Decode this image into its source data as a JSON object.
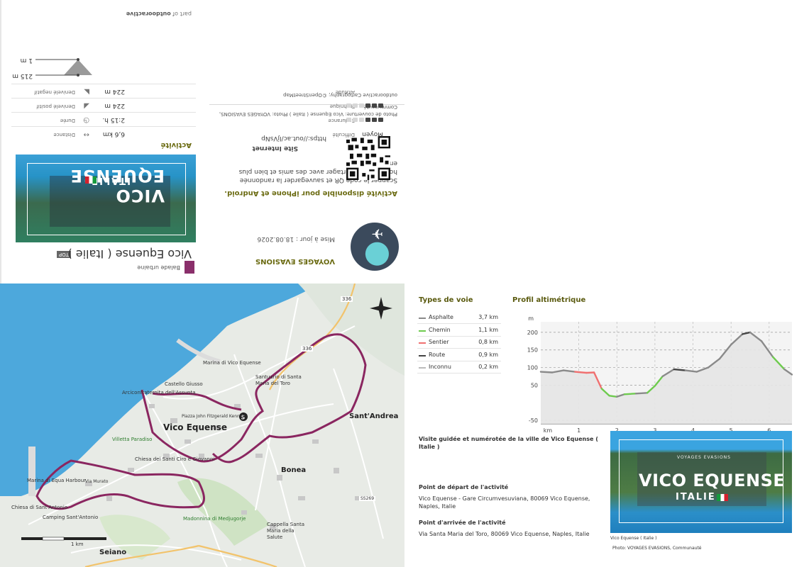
{
  "back_cover": {
    "part_of_prefix": "part of ",
    "part_of_brand": "outdooractive",
    "brand_name": "VOYAGES EVASIONS",
    "updated": "Mise à jour : 18.08.2026",
    "app_title": "Activité disponible pour iPhone et Android.",
    "app_desc": "Scanner le code QR et sauvegarder la randonnée hors-ligne, la partager avec des amis et bien plus encore ...",
    "website_label": "Site Internet",
    "website_url": "https://out.ac/IjVsNp",
    "photo_credit": "Photo de couverture: Vico Equense ( Italie ) Photo: VOYAGES EVASIONS, Communauté",
    "cartography": "outdooractive Cartography; ©OpenStreetMap",
    "activity_type": "Balade urbaine",
    "top_badge": "TOP",
    "main_title": "Vico Equense ( Italie )",
    "cover_title": "VICO EQUENSE",
    "cover_subtitle": "ITALIE",
    "activity_heading": "Activité",
    "stats": [
      {
        "label": "Distance",
        "value": "6,6  km",
        "extra_label": "Difficulté",
        "extra_value": "Moyen"
      },
      {
        "label": "Durée",
        "value": "2:15  h.",
        "extra_label": "Endurance",
        "level": 3
      },
      {
        "label": "Denivelé positif",
        "value": "224  m",
        "extra_label": "Technique",
        "level": 3
      },
      {
        "label": "Denivelé negatif",
        "value": "224  m",
        "extra_label": "Altitude"
      }
    ],
    "altitude_max": "215 m",
    "altitude_min": "1 m"
  },
  "map": {
    "places": {
      "vico": "Vico Equense",
      "bonea": "Bonea",
      "sant_andrea": "Sant'Andrea",
      "seiano": "Seiano",
      "marina_equa": "Marina di Equa Harbour",
      "chiesa_sant_antonio": "Chiesa di Sant'Antonio",
      "camping": "Camping Sant'Antonio",
      "villetta": "Villetta Paradiso",
      "madonnina": "Madonnina di Medjugorje",
      "cappella": "Cappella Santa Maria della Salute",
      "santuario": "Santuario di Santa Maria del Toro",
      "marina_vico": "Marina di Vico Equense",
      "arciconfraternita": "Arciconfraternita dell'Assunta",
      "castello": "Castello Giusso",
      "piazza": "Piazza John Fitzgerald Kennedy",
      "chiesa_giovanni": "Chiesa dei Santi Ciro e Giovanni",
      "road_336": "336",
      "road_sp": "SS269",
      "murato": "Via Murato"
    },
    "scale_label": "1 km"
  },
  "info": {
    "types_title": "Types de voie",
    "types": [
      {
        "name": "Asphalte",
        "dist": "3,7 km",
        "color": "#8a8a8a"
      },
      {
        "name": "Chemin",
        "dist": "1,1 km",
        "color": "#6ecb4e"
      },
      {
        "name": "Sentier",
        "dist": "0,8 km",
        "color": "#f07070"
      },
      {
        "name": "Route",
        "dist": "0,9 km",
        "color": "#444444"
      },
      {
        "name": "Inconnu",
        "dist": "0,2 km",
        "color": "#bbbbbb"
      }
    ],
    "profile_title": "Profil altimétrique",
    "description": "Visite guidée et numérotée de la ville de Vico Equense ( Italie )",
    "start_title": "Point de départ de l'activité",
    "start_text": "Vico Equense - Gare Circumvesuviana, 80069 Vico Equense, Naples, Italie",
    "end_title": "Point d'arrivée de l'activité",
    "end_text": "Via Santa Maria del Toro, 80069 Vico Equense, Naples, Italie",
    "cover_caption": "Vico Equense ( Italie )",
    "cover_credit": "Photo: VOYAGES EVASIONS, Communauté",
    "cover_title": "VICO EQUENSE",
    "cover_subtitle": "ITALIE",
    "cover_brand": "VOYAGES EVASIONS"
  },
  "chart_data": {
    "type": "area",
    "title": "Profil altimétrique",
    "xlabel": "km",
    "ylabel": "m",
    "x_ticks": [
      1,
      2,
      3,
      4,
      5,
      6
    ],
    "y_ticks": [
      -50,
      50,
      100,
      150,
      200
    ],
    "xlim": [
      0,
      6.6
    ],
    "ylim": [
      -60,
      230
    ],
    "grid": true,
    "x": [
      0,
      0.3,
      0.6,
      0.9,
      1.2,
      1.4,
      1.6,
      1.8,
      2.0,
      2.2,
      2.5,
      2.8,
      3.0,
      3.2,
      3.5,
      3.8,
      4.1,
      4.4,
      4.7,
      5.0,
      5.3,
      5.5,
      5.8,
      6.1,
      6.4,
      6.6
    ],
    "y": [
      88,
      86,
      92,
      88,
      85,
      86,
      40,
      20,
      17,
      24,
      26,
      28,
      48,
      75,
      95,
      92,
      88,
      100,
      125,
      165,
      195,
      200,
      175,
      130,
      95,
      80
    ]
  }
}
